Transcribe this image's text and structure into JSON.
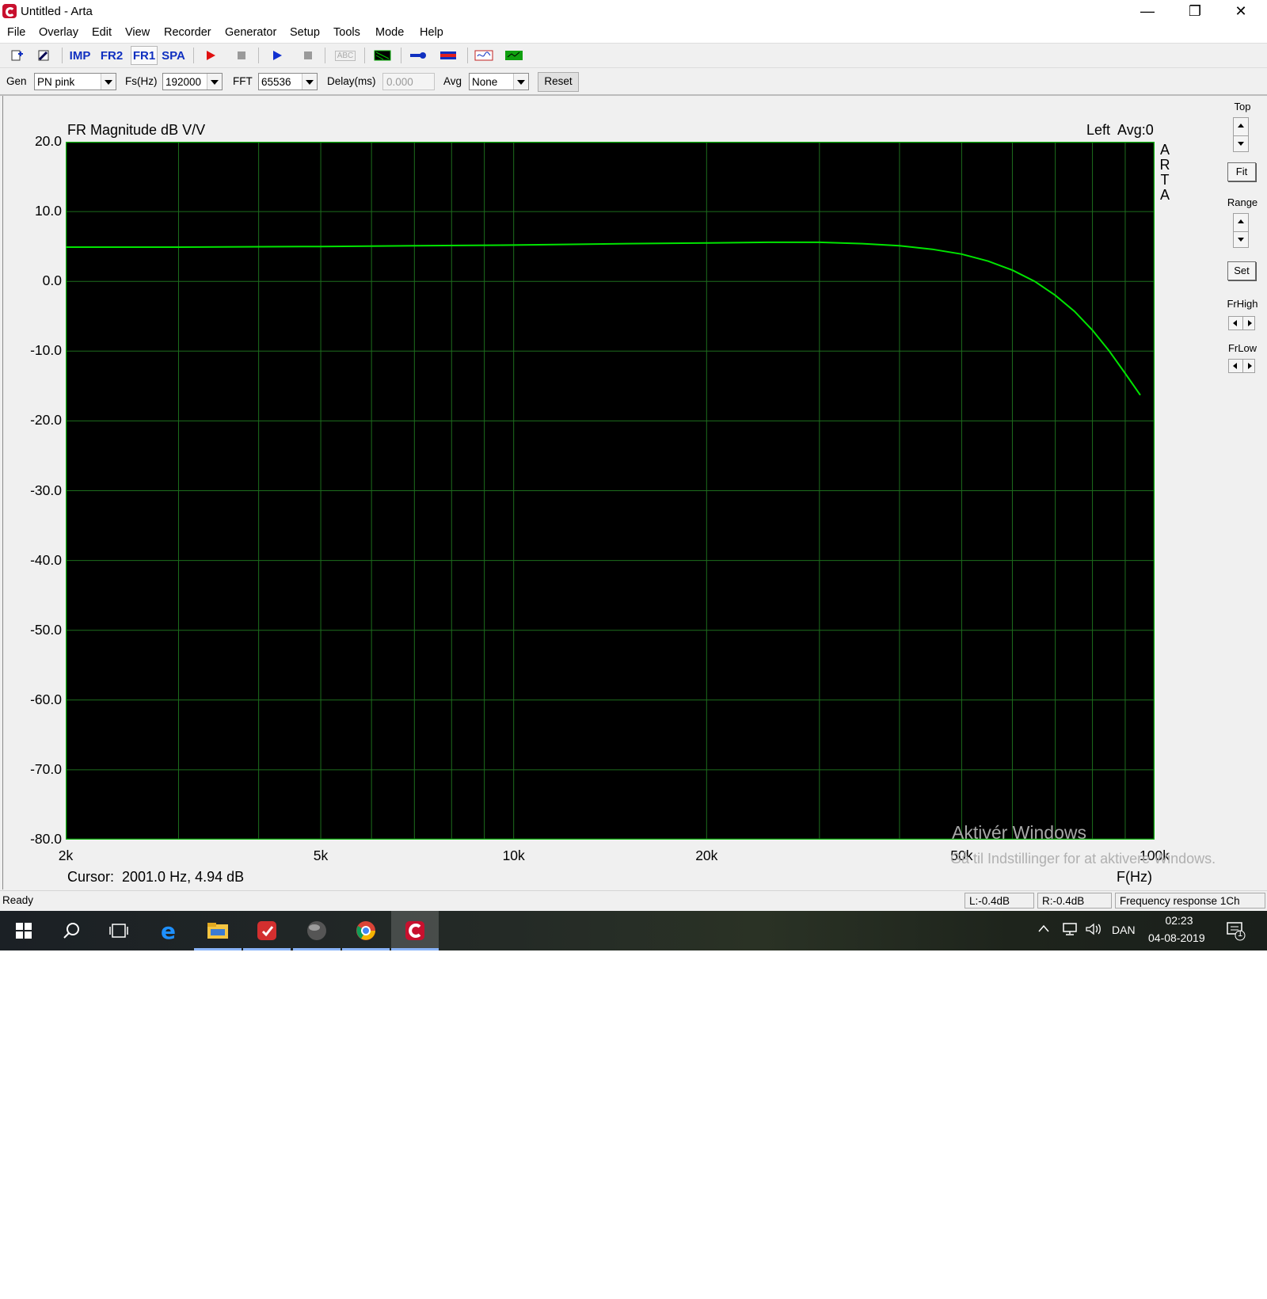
{
  "window": {
    "title": "Untitled - Arta"
  },
  "menu": [
    "File",
    "Overlay",
    "Edit",
    "View",
    "Recorder",
    "Generator",
    "Setup",
    "Tools",
    "Mode",
    "Help"
  ],
  "toolbar": {
    "imp": "IMP",
    "fr2": "FR2",
    "fr1": "FR1",
    "spa": "SPA",
    "abc": "ABC"
  },
  "controls": {
    "gen_label": "Gen",
    "gen_value": "PN pink",
    "fs_label": "Fs(Hz)",
    "fs_value": "192000",
    "fft_label": "FFT",
    "fft_value": "65536",
    "delay_label": "Delay(ms)",
    "delay_value": "0.000",
    "avg_label": "Avg",
    "avg_value": "None",
    "reset_label": "Reset"
  },
  "chart": {
    "title": "FR Magnitude dB V/V",
    "channel_info": "Left  Avg:0",
    "brand_vertical": [
      "A",
      "R",
      "T",
      "A"
    ],
    "cursor": "Cursor:  2001.0 Hz, 4.94 dB",
    "watermark_line1": "Aktivér Windows",
    "watermark_line2": "Gå til Indstillinger for at aktivere Windows."
  },
  "side_panel": {
    "top_label": "Top",
    "fit_label": "Fit",
    "range_label": "Range",
    "set_label": "Set",
    "frhigh_label": "FrHigh",
    "frlow_label": "FrLow"
  },
  "status": {
    "ready": "Ready",
    "left_level": "L:-0.4dB",
    "right_level": "R:-0.4dB",
    "mode": "Frequency response 1Ch"
  },
  "taskbar": {
    "language": "DAN",
    "time": "02:23",
    "date": "04-08-2019",
    "notification_count": "1"
  },
  "colors": {
    "plot_bg": "#000000",
    "grid": "#1d6e1d",
    "trace": "#00e400",
    "frame": "#00b000"
  },
  "chart_data": {
    "type": "line",
    "title": "FR Magnitude dB V/V",
    "xlabel": "F(Hz)",
    "ylabel": "",
    "x_scale": "log",
    "xlim": [
      2000,
      100000
    ],
    "ylim": [
      -80,
      20
    ],
    "x_tick_labels": [
      "2k",
      "5k",
      "10k",
      "20k",
      "50k",
      "100k"
    ],
    "x_tick_values": [
      2000,
      5000,
      10000,
      20000,
      50000,
      100000
    ],
    "y_tick_labels": [
      "20.0",
      "10.0",
      "0.0",
      "-10.0",
      "-20.0",
      "-30.0",
      "-40.0",
      "-50.0",
      "-60.0",
      "-70.0",
      "-80.0"
    ],
    "y_tick_values": [
      20,
      10,
      0,
      -10,
      -20,
      -30,
      -40,
      -50,
      -60,
      -70,
      -80
    ],
    "grid": true,
    "series": [
      {
        "x": [
          2000,
          3000,
          5000,
          7000,
          10000,
          15000,
          20000,
          25000,
          30000,
          35000,
          40000,
          45000,
          50000,
          55000,
          60000,
          65000,
          70000,
          75000,
          80000,
          85000,
          90000,
          95000
        ],
        "y": [
          4.9,
          4.9,
          5.0,
          5.1,
          5.2,
          5.4,
          5.5,
          5.6,
          5.6,
          5.4,
          5.1,
          4.6,
          3.9,
          2.9,
          1.6,
          0.0,
          -2.0,
          -4.3,
          -7.0,
          -10.0,
          -13.2,
          -16.3
        ]
      }
    ]
  }
}
